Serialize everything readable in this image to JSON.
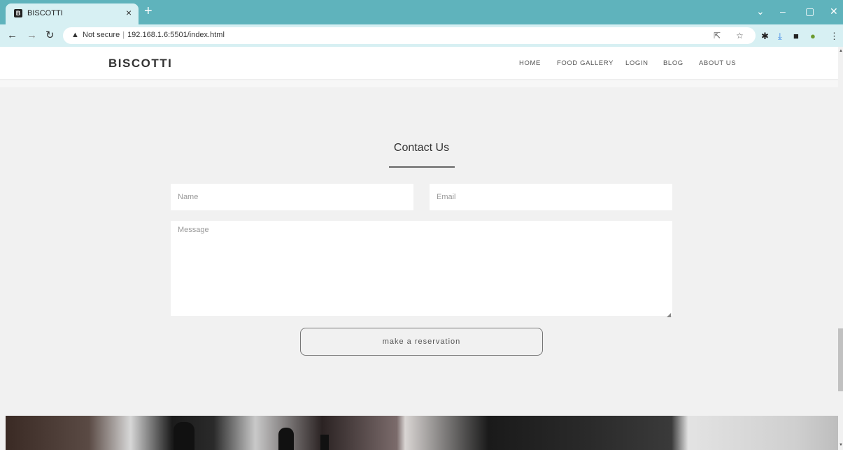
{
  "browser": {
    "tab_title": "BISCOTTI",
    "tab_favicon": "B",
    "close_tab_glyph": "×",
    "new_tab_glyph": "+",
    "address_security": "Not secure",
    "address_url": "192.168.1.6:5501/index.html",
    "icons": {
      "back": "back-arrow-icon",
      "forward": "forward-arrow-icon",
      "reload": "reload-icon",
      "share": "share-icon",
      "bookmark": "star-icon",
      "extensions": "puzzle-icon",
      "download": "download-icon",
      "sidepanel": "side-panel-icon",
      "profile": "profile-avatar-icon",
      "menu": "kebab-menu-icon"
    }
  },
  "navbar": {
    "brand": "BISCOTTI",
    "items": [
      {
        "label": "HOME"
      },
      {
        "label": "FOOD GALLERY"
      },
      {
        "label": "LOGIN"
      },
      {
        "label": "BLOG"
      },
      {
        "label": "ABOUT US"
      }
    ]
  },
  "contact": {
    "title": "Contact Us",
    "name_placeholder": "Name",
    "email_placeholder": "Email",
    "message_placeholder": "Message",
    "submit_label": "make a reservation"
  },
  "colors": {
    "chrome_tabstrip": "#5fb3bc",
    "chrome_toolbar": "#d7f0f3",
    "page_background": "#f1f1f1",
    "text_dark": "#333333"
  }
}
